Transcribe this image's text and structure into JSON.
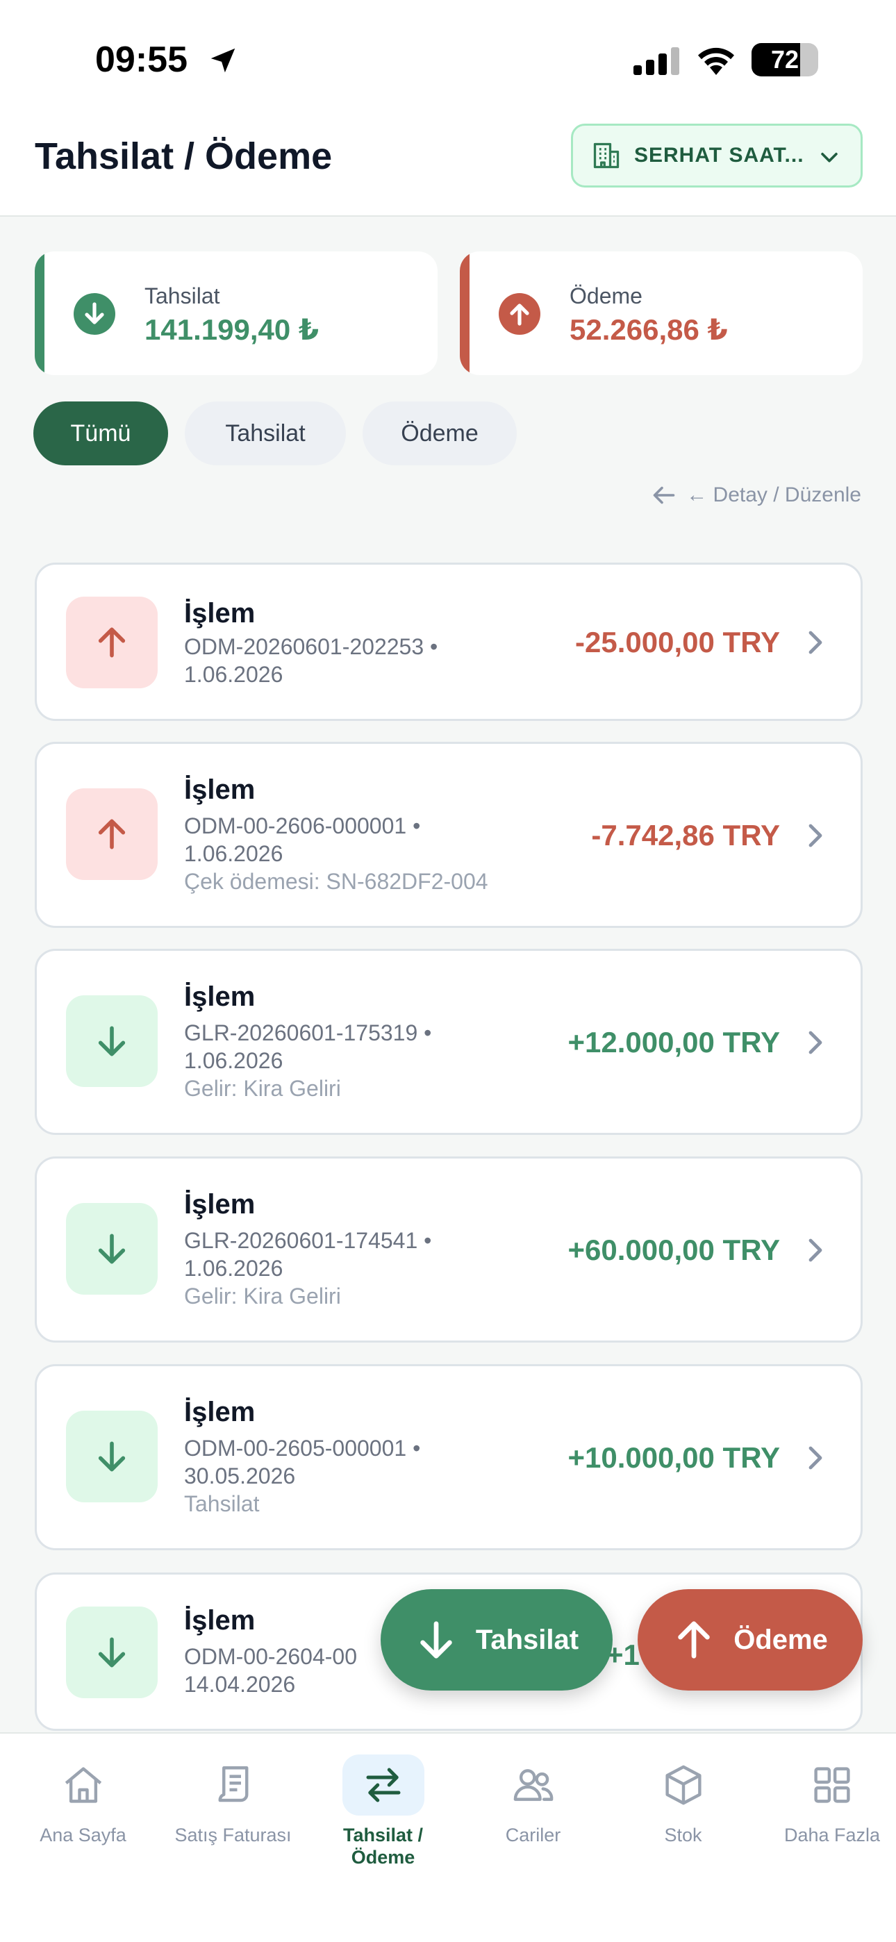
{
  "status_bar": {
    "time": "09:55",
    "battery": "72"
  },
  "header": {
    "title": "Tahsilat / Ödeme",
    "company": "SERHAT SAAT..."
  },
  "summary": {
    "collection": {
      "label": "Tahsilat",
      "value": "141.199,40 ₺"
    },
    "payment": {
      "label": "Ödeme",
      "value": "52.266,86 ₺"
    }
  },
  "filters": [
    "Tümü",
    "Tahsilat",
    "Ödeme"
  ],
  "hint": "← Detay / Düzenle",
  "transactions": [
    {
      "title": "İşlem",
      "line1": "ODM-20260601-202253 •",
      "line2": "1.06.2026",
      "note": "",
      "amount": "-25.000,00 TRY"
    },
    {
      "title": "İşlem",
      "line1": "ODM-00-2606-000001 •",
      "line2": "1.06.2026",
      "note": "Çek ödemesi: SN-682DF2-004",
      "amount": "-7.742,86 TRY"
    },
    {
      "title": "İşlem",
      "line1": "GLR-20260601-175319 •",
      "line2": "1.06.2026",
      "note": "Gelir: Kira Geliri",
      "amount": "+12.000,00 TRY"
    },
    {
      "title": "İşlem",
      "line1": "GLR-20260601-174541 •",
      "line2": "1.06.2026",
      "note": "Gelir: Kira Geliri",
      "amount": "+60.000,00 TRY"
    },
    {
      "title": "İşlem",
      "line1": "ODM-00-2605-000001 •",
      "line2": "30.05.2026",
      "note": "Tahsilat",
      "amount": "+10.000,00 TRY"
    },
    {
      "title": "İşlem",
      "line1": "ODM-00-2604-00",
      "line2": "14.04.2026",
      "note": "",
      "amount": "+1"
    }
  ],
  "fabs": {
    "collection": "Tahsilat",
    "payment": "Ödeme"
  },
  "nav": [
    {
      "label": "Ana Sayfa",
      "icon": "home-icon"
    },
    {
      "label": "Satış Faturası",
      "icon": "invoice-icon"
    },
    {
      "label": "Tahsilat / Ödeme",
      "icon": "transfer-icon"
    },
    {
      "label": "Cariler",
      "icon": "users-icon"
    },
    {
      "label": "Stok",
      "icon": "box-icon"
    },
    {
      "label": "Daha Fazla",
      "icon": "grid-icon"
    }
  ],
  "colors": {
    "green": "#3f8f68",
    "red": "#c45a48",
    "active_green": "#2a6648",
    "red_bg": "#fde1e1",
    "green_bg": "#dff8e8"
  }
}
